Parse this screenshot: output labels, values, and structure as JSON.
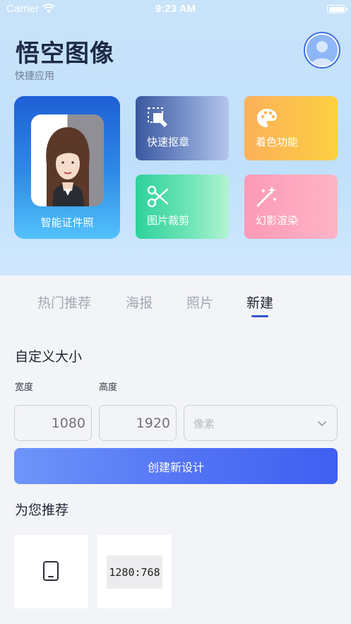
{
  "status_bar": {
    "carrier": "Carrier",
    "time": "9:23 AM"
  },
  "header": {
    "title": "悟空图像",
    "subtitle": "快捷应用"
  },
  "features": {
    "id_photo": {
      "label": "智能证件照"
    },
    "tiles": [
      {
        "label": "快速抠章",
        "icon": "stamp-cutout-icon"
      },
      {
        "label": "着色功能",
        "icon": "palette-icon"
      },
      {
        "label": "图片裁剪",
        "icon": "scissors-icon"
      },
      {
        "label": "幻影渲染",
        "icon": "magic-wand-icon"
      }
    ]
  },
  "tabs": [
    {
      "label": "热门推荐",
      "active": false
    },
    {
      "label": "海报",
      "active": false
    },
    {
      "label": "照片",
      "active": false
    },
    {
      "label": "新建",
      "active": true
    }
  ],
  "custom_size": {
    "title": "自定义大小",
    "width_label": "宽度",
    "height_label": "高度",
    "width_placeholder": "1080",
    "height_placeholder": "1920",
    "unit_value": "像素",
    "create_label": "创建新设计"
  },
  "recommend": {
    "title": "为您推荐",
    "cards": [
      {
        "icon": "tablet-icon",
        "label": ""
      },
      {
        "ratio": "1280:768",
        "label": ""
      }
    ]
  },
  "colors": {
    "accent": "#3554cf",
    "button_start": "#6e95fa",
    "button_end": "#3f5ff1"
  }
}
